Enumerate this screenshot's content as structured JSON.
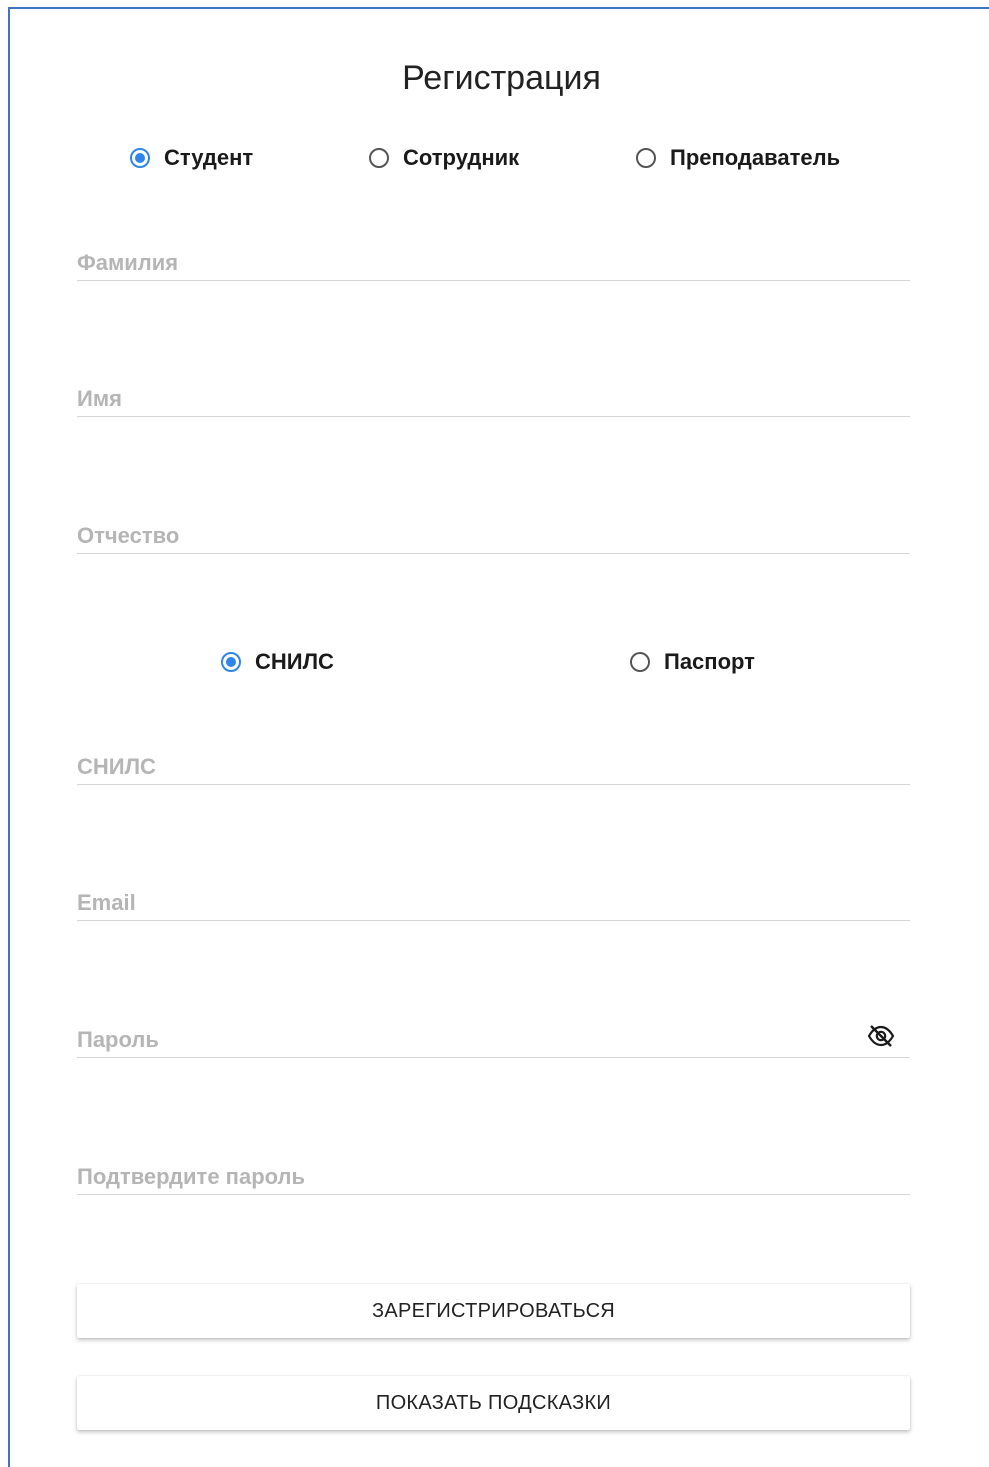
{
  "title": "Регистрация",
  "role_options": [
    {
      "label": "Студент",
      "checked": true
    },
    {
      "label": "Сотрудник",
      "checked": false
    },
    {
      "label": "Преподаватель",
      "checked": false
    }
  ],
  "fields": {
    "last_name": {
      "placeholder": "Фамилия",
      "value": ""
    },
    "first_name": {
      "placeholder": "Имя",
      "value": ""
    },
    "patronymic": {
      "placeholder": "Отчество",
      "value": ""
    },
    "snils": {
      "placeholder": "СНИЛС",
      "value": ""
    },
    "email": {
      "placeholder": "Email",
      "value": ""
    },
    "password": {
      "placeholder": "Пароль",
      "value": ""
    },
    "confirm_password": {
      "placeholder": "Подтвердите пароль",
      "value": ""
    }
  },
  "document_options": [
    {
      "label": "СНИЛС",
      "checked": true
    },
    {
      "label": "Паспорт",
      "checked": false
    }
  ],
  "buttons": {
    "register": "ЗАРЕГИСТРИРОВАТЬСЯ",
    "show_hints": "ПОКАЗАТЬ ПОДСКАЗКИ"
  },
  "colors": {
    "accent": "#2f86e8",
    "frame": "#3f74c4",
    "placeholder": "#b5b5b5",
    "divider": "#d6d6d6"
  },
  "icons": {
    "password_toggle": "eye-off-icon"
  }
}
